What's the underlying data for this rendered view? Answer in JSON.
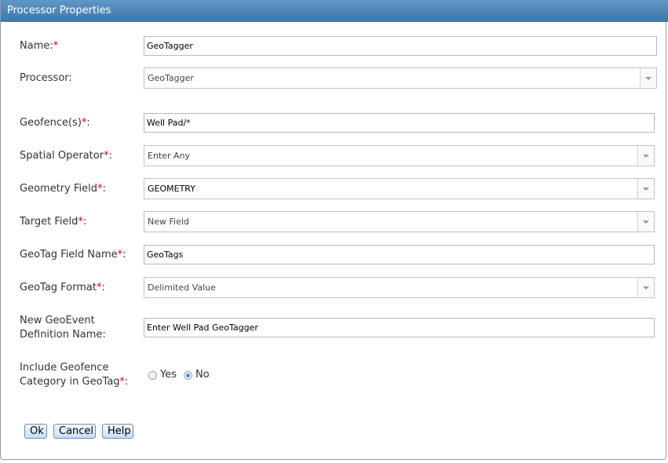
{
  "dialog": {
    "title": "Processor Properties"
  },
  "fields": {
    "name": {
      "label": "Name:",
      "value": "GeoTagger"
    },
    "processor": {
      "label": "Processor:",
      "value": "GeoTagger"
    },
    "geofences": {
      "label": "Geofence(s)",
      "value": "Well Pad/*"
    },
    "spatial_operator": {
      "label": "Spatial Operator",
      "value": "Enter Any"
    },
    "geometry_field": {
      "label": "Geometry Field",
      "value": "GEOMETRY"
    },
    "target_field": {
      "label": "Target Field",
      "value": "New Field"
    },
    "geotag_field_name": {
      "label": "GeoTag Field Name",
      "value": "GeoTags"
    },
    "geotag_format": {
      "label": "GeoTag Format",
      "value": "Delimited Value"
    },
    "new_geoevent_def": {
      "label_line1": "New GeoEvent",
      "label_line2": "Definition Name:",
      "value": "Enter Well Pad GeoTagger"
    },
    "include_category": {
      "label_line1": "Include Geofence",
      "label_line2": "Category in GeoTag",
      "option_yes": "Yes",
      "option_no": "No",
      "selected": "No"
    }
  },
  "common": {
    "required_mark": "*",
    "colon": ":"
  },
  "buttons": {
    "ok": "Ok",
    "cancel": "Cancel",
    "help": "Help"
  }
}
